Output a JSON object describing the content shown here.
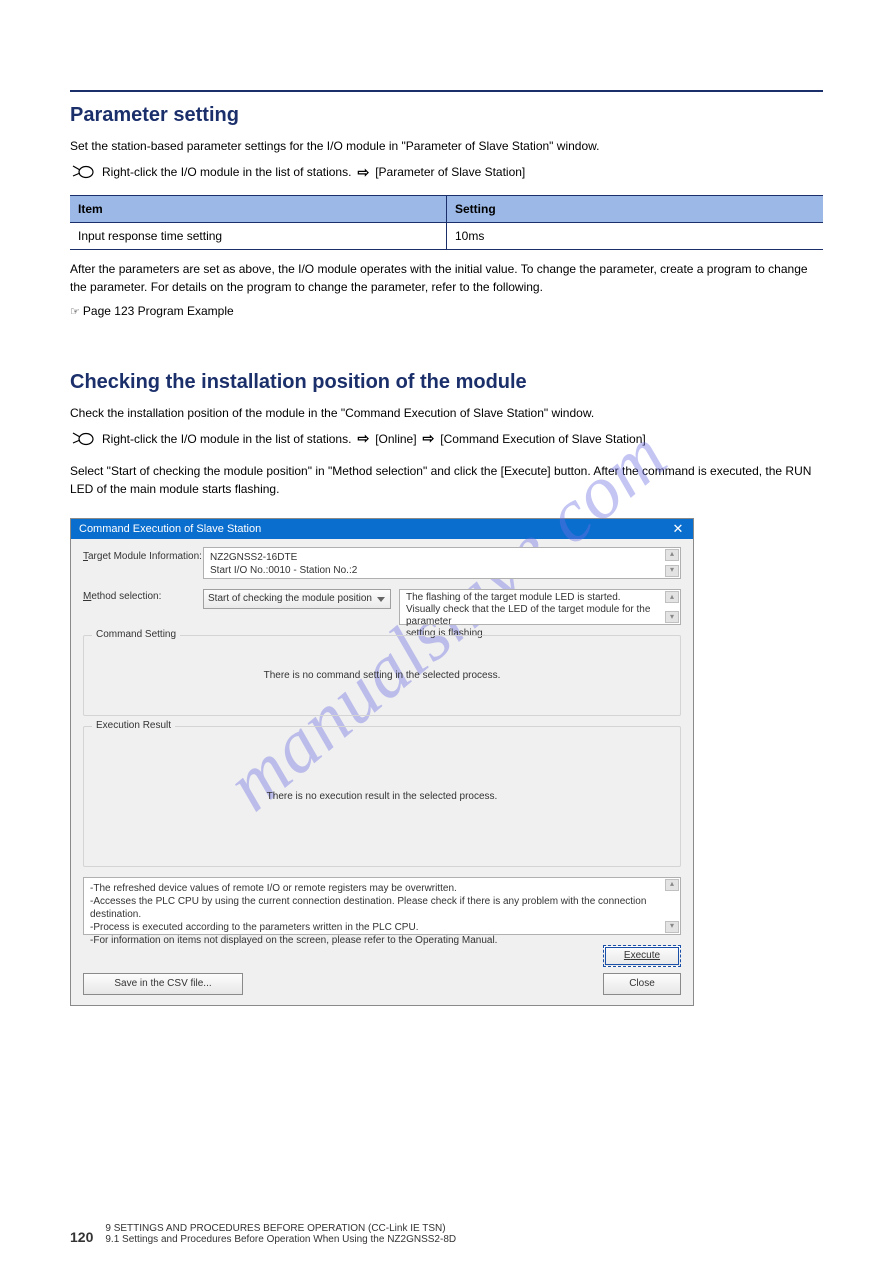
{
  "page": {
    "hr_top": true,
    "section1": {
      "title": "Parameter setting",
      "intro": "Set the station-based parameter settings for the I/O module in \"Parameter of Slave Station\" window.",
      "nav_items": [
        "Right-click the I/O module in the list of stations.",
        "[Parameter of Slave Station]"
      ],
      "table": {
        "headers": [
          "Item",
          "Setting"
        ],
        "rows": [
          [
            "Input response time setting",
            "10ms"
          ]
        ]
      },
      "post_text": "After the parameters are set as above, the I/O module operates with the initial value. To change the parameter, create a program to change the parameter. For details on the program to change the parameter, refer to the following.",
      "ref_link": "Page 123 Program Example"
    },
    "section2": {
      "title": "Checking the installation position of the module",
      "intro": "Check the installation position of the module in the \"Command Execution of Slave Station\" window.",
      "nav_items": [
        "Right-click the I/O module in the list of stations.",
        "[Online]",
        "[Command Execution of Slave Station]"
      ],
      "post_nav": "Select \"Start of checking the module position\" in \"Method selection\" and click the [Execute] button. After the command is executed, the RUN LED of the main module starts flashing.",
      "dialog": {
        "title": "Command Execution of Slave Station",
        "target_label": "Target Module Information:",
        "target_value_line1": "NZ2GNSS2-16DTE",
        "target_value_line2": "Start I/O No.:0010 - Station No.:2",
        "method_label": "Method selection:",
        "method_value": "Start of checking the module position",
        "method_desc_line1": "The flashing of the target module LED is started.",
        "method_desc_line2": "Visually check that the LED of the target module for the parameter",
        "method_desc_line3": "setting is flashing.",
        "cmd_setting_label": "Command Setting",
        "cmd_setting_msg": "There is no command setting in the selected process.",
        "exec_result_label": "Execution Result",
        "exec_result_msg": "There is no execution result in the selected process.",
        "notes_line1": "-The refreshed device values of remote I/O or remote registers may be overwritten.",
        "notes_line2": "-Accesses the PLC CPU by using the current connection destination. Please check if there is any problem with the connection destination.",
        "notes_line3": "-Process is executed according to the parameters written in the PLC CPU.",
        "notes_line4": "-For information on items not displayed on the screen, please refer to the Operating Manual.",
        "btn_execute": "Execute",
        "btn_csv": "Save in the CSV file...",
        "btn_close": "Close"
      }
    },
    "watermark": "manualshive.com",
    "footer": {
      "page_number": "120",
      "chapter_line1": "9  SETTINGS AND PROCEDURES BEFORE OPERATION (CC-Link IE TSN)",
      "chapter_line2": "9.1  Settings and Procedures Before Operation When Using the NZ2GNSS2-8D"
    }
  }
}
